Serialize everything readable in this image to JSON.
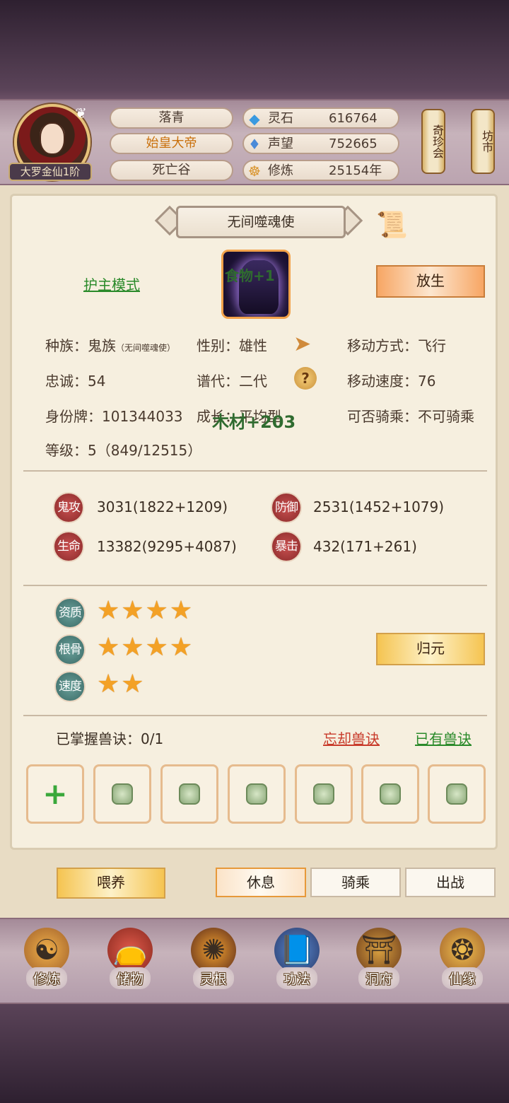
{
  "header": {
    "rank": "大罗金仙1阶",
    "name": "落青",
    "title": "始皇大帝",
    "location": "死亡谷",
    "resources": [
      {
        "icon": "crystal-icon",
        "name": "灵石",
        "value": "616764"
      },
      {
        "icon": "flame-icon",
        "name": "声望",
        "value": "752665"
      },
      {
        "icon": "meditation-icon",
        "name": "修炼",
        "value": "25154年"
      }
    ],
    "shop_buttons": [
      "奇珍会",
      "坊市"
    ]
  },
  "pet": {
    "title": "无间噬魂使",
    "guard_mode": "护主模式",
    "release": "放生",
    "float_food": "食物+1",
    "float_wood": "木材+203",
    "info": {
      "race_label": "种族：",
      "race": "鬼族",
      "race_sub": "（无间噬魂使）",
      "gender_label": "性别：",
      "gender": "雄性",
      "move_label": "移动方式：",
      "move": "飞行",
      "loyalty_label": "忠诚：",
      "loyalty": "54",
      "gen_label": "谱代：",
      "gen": "二代",
      "speed_label": "移动速度：",
      "speed": "76",
      "id_label": "身份牌：",
      "id": "101344033",
      "growth_label": "成长：",
      "growth": "平均型",
      "ride_label": "可否骑乘：",
      "ride": "不可骑乘",
      "level_label": "等级：",
      "level": "5（849/12515）"
    },
    "stats": [
      {
        "badge": "鬼攻",
        "value": "3031(1822+1209)"
      },
      {
        "badge": "防御",
        "value": "2531(1452+1079)"
      },
      {
        "badge": "生命",
        "value": "13382(9295+4087)"
      },
      {
        "badge": "暴击",
        "value": "432(171+261)"
      }
    ],
    "aptitudes": [
      {
        "badge": "资质",
        "stars": 4,
        "stars_text": "★★★★"
      },
      {
        "badge": "根骨",
        "stars": 4,
        "stars_text": "★★★★"
      },
      {
        "badge": "速度",
        "stars": 2,
        "stars_text": "★★"
      }
    ],
    "restore": "归元",
    "mastered": "已掌握兽诀：0/1",
    "forget": "忘却兽诀",
    "owned": "已有兽诀",
    "slot_plus": "+"
  },
  "actions": {
    "feed": "喂养",
    "rest": "休息",
    "ride": "骑乘",
    "battle": "出战"
  },
  "nav": [
    "修炼",
    "储物",
    "灵根",
    "功法",
    "洞府",
    "仙缘"
  ]
}
